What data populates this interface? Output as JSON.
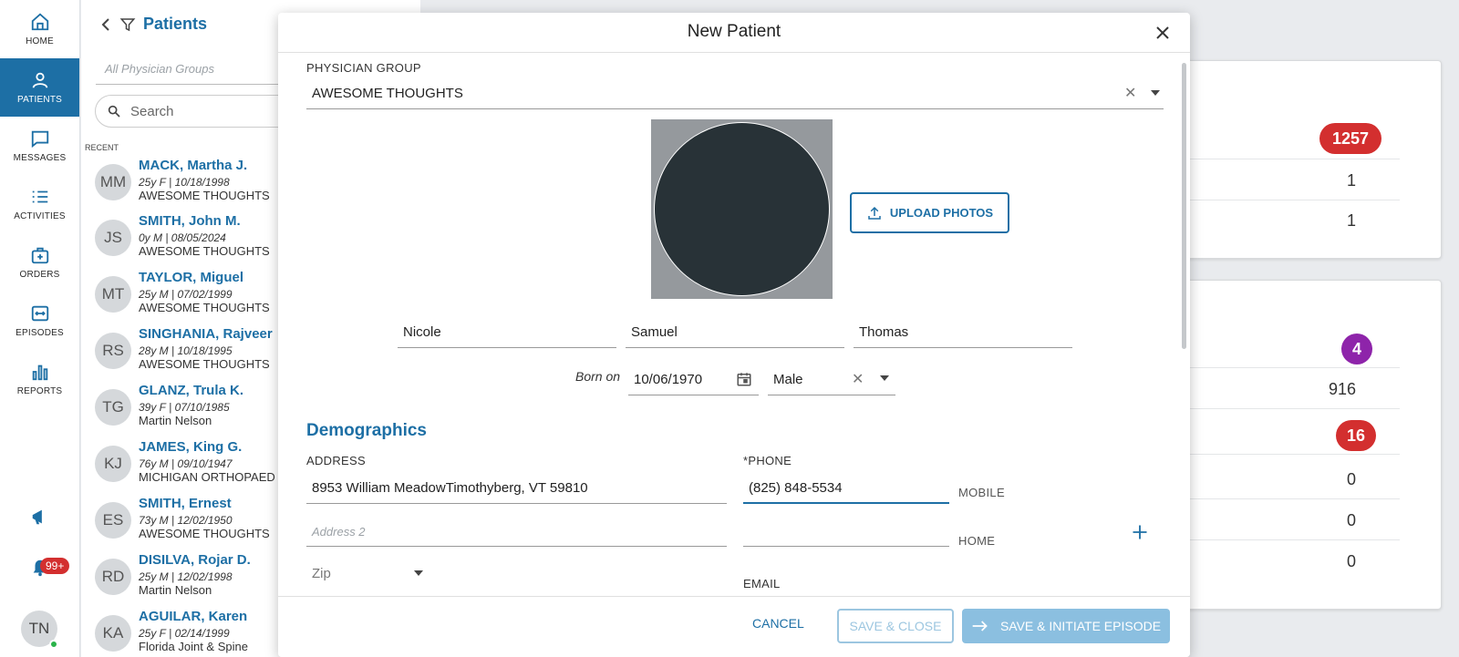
{
  "nav": {
    "items": [
      {
        "label": "HOME",
        "icon": "home-icon"
      },
      {
        "label": "PATIENTS",
        "icon": "person-icon"
      },
      {
        "label": "MESSAGES",
        "icon": "message-icon"
      },
      {
        "label": "ACTIVITIES",
        "icon": "list-icon"
      },
      {
        "label": "ORDERS",
        "icon": "medical-bag-icon"
      },
      {
        "label": "EPISODES",
        "icon": "episodes-icon"
      },
      {
        "label": "REPORTS",
        "icon": "bar-chart-icon"
      }
    ],
    "notification_count": "99+",
    "user_initials": "TN"
  },
  "patients_panel": {
    "title": "Patients",
    "group_filter_placeholder": "All Physician Groups",
    "search_placeholder": "Search",
    "recent_label": "RECENT",
    "patients": [
      {
        "initials": "MM",
        "name": "MACK, Martha J.",
        "meta": "25y F | 10/18/1998",
        "group": "AWESOME THOUGHTS"
      },
      {
        "initials": "JS",
        "name": "SMITH, John M.",
        "meta": "0y M | 08/05/2024",
        "group": "AWESOME THOUGHTS"
      },
      {
        "initials": "MT",
        "name": "TAYLOR, Miguel",
        "meta": "25y M | 07/02/1999",
        "group": "AWESOME THOUGHTS"
      },
      {
        "initials": "RS",
        "name": "SINGHANIA, Rajveer",
        "meta": "28y M | 10/18/1995",
        "group": "AWESOME THOUGHTS"
      },
      {
        "initials": "TG",
        "name": "GLANZ, Trula K.",
        "meta": "39y F | 07/10/1985",
        "group": "Martin Nelson"
      },
      {
        "initials": "KJ",
        "name": "JAMES, King G.",
        "meta": "76y M | 09/10/1947",
        "group": "MICHIGAN ORTHOPAED"
      },
      {
        "initials": "ES",
        "name": "SMITH, Ernest",
        "meta": "73y M | 12/02/1950",
        "group": "AWESOME THOUGHTS"
      },
      {
        "initials": "RD",
        "name": "DISILVA, Rojar D.",
        "meta": "25y M | 12/02/1998",
        "group": "Martin Nelson"
      },
      {
        "initials": "KA",
        "name": "AGUILAR, Karen",
        "meta": "25y F | 02/14/1999",
        "group": "Florida Joint & Spine"
      }
    ]
  },
  "bg_cards": {
    "card1": {
      "pill": "1257",
      "v1": "1",
      "v2": "1"
    },
    "card2": {
      "pill_purple": "4",
      "v1": "916",
      "pill_red": "16",
      "v2": "0",
      "v3": "0",
      "v4": "0"
    }
  },
  "modal": {
    "title": "New Patient",
    "physician_group_label": "PHYSICIAN GROUP",
    "physician_group_value": "AWESOME THOUGHTS",
    "upload_label": "UPLOAD PHOTOS",
    "first_name": "Nicole",
    "middle_name": "Samuel",
    "last_name": "Thomas",
    "born_on_label": "Born on",
    "dob": "10/06/1970",
    "sex": "Male",
    "demographics_title": "Demographics",
    "address_label": "ADDRESS",
    "address1": "8953 William MeadowTimothyberg, VT 59810",
    "address2_placeholder": "Address 2",
    "zip_placeholder": "Zip",
    "phone_label": "*PHONE",
    "phone_value": "(825) 848-5534",
    "phone_type1": "MOBILE",
    "phone_type2": "HOME",
    "email_label": "EMAIL",
    "cancel_label": "CANCEL",
    "save_close_label": "SAVE & CLOSE",
    "save_initiate_label": "SAVE & INITIATE EPISODE"
  },
  "colors": {
    "accent": "#1d6fa5",
    "badge_red": "#d32f2f",
    "badge_purple": "#8e24aa"
  }
}
